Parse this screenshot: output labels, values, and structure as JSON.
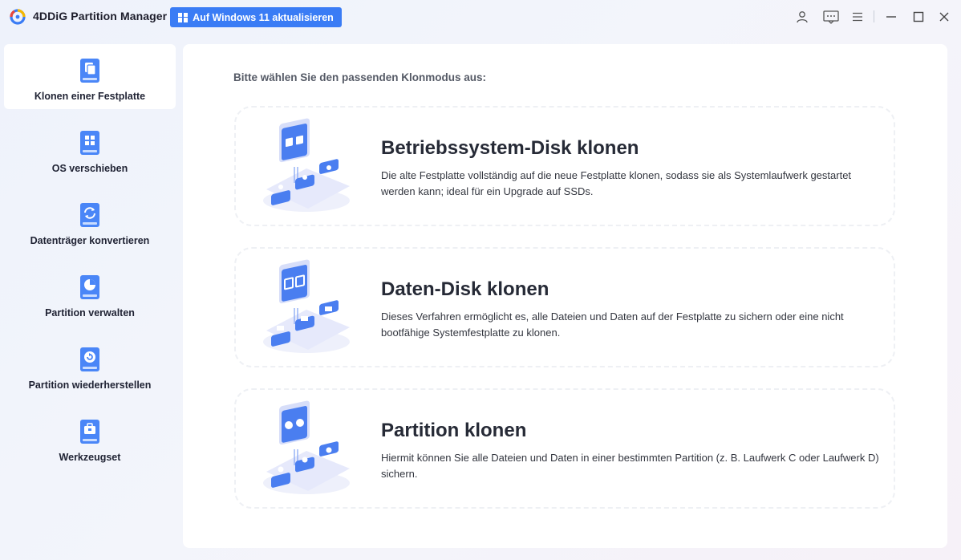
{
  "app": {
    "title": "4DDiG Partition Manager",
    "upgrade_label": "Auf Windows 11 aktualisieren"
  },
  "titlebar_icons": [
    "user-icon",
    "feedback-icon",
    "menu-icon",
    "minimize-icon",
    "maximize-icon",
    "close-icon"
  ],
  "sidebar": {
    "items": [
      {
        "label": "Klonen einer Festplatte",
        "icon": "clone-disk-icon",
        "active": true
      },
      {
        "label": "OS verschieben",
        "icon": "os-migrate-icon",
        "active": false
      },
      {
        "label": "Datenträger konvertieren",
        "icon": "convert-disk-icon",
        "active": false
      },
      {
        "label": "Partition verwalten",
        "icon": "manage-partition-icon",
        "active": false
      },
      {
        "label": "Partition wiederherstellen",
        "icon": "recover-partition-icon",
        "active": false
      },
      {
        "label": "Werkzeugset",
        "icon": "toolkit-icon",
        "active": false
      }
    ]
  },
  "main": {
    "prompt": "Bitte wählen Sie den passenden Klonmodus aus:",
    "cards": [
      {
        "title": "Betriebssystem-Disk klonen",
        "description": "Die alte Festplatte vollständig auf die neue Festplatte klonen, sodass sie als Systemlaufwerk gestartet werden kann; ideal für ein Upgrade auf SSDs.",
        "icon": "os-disk-clone-illustration"
      },
      {
        "title": "Daten-Disk klonen",
        "description": "Dieses Verfahren ermöglicht es, alle Dateien und Daten auf der Festplatte zu sichern oder eine nicht bootfähige Systemfestplatte zu klonen.",
        "icon": "data-disk-clone-illustration"
      },
      {
        "title": "Partition klonen",
        "description": "Hiermit können Sie alle Dateien und Daten in einer bestimmten Partition (z. B. Laufwerk C oder Laufwerk D) sichern.",
        "icon": "partition-clone-illustration"
      }
    ]
  },
  "colors": {
    "accent": "#3a7cf5",
    "icon_blue": "#4a86f7",
    "text_dark": "#262a36"
  }
}
